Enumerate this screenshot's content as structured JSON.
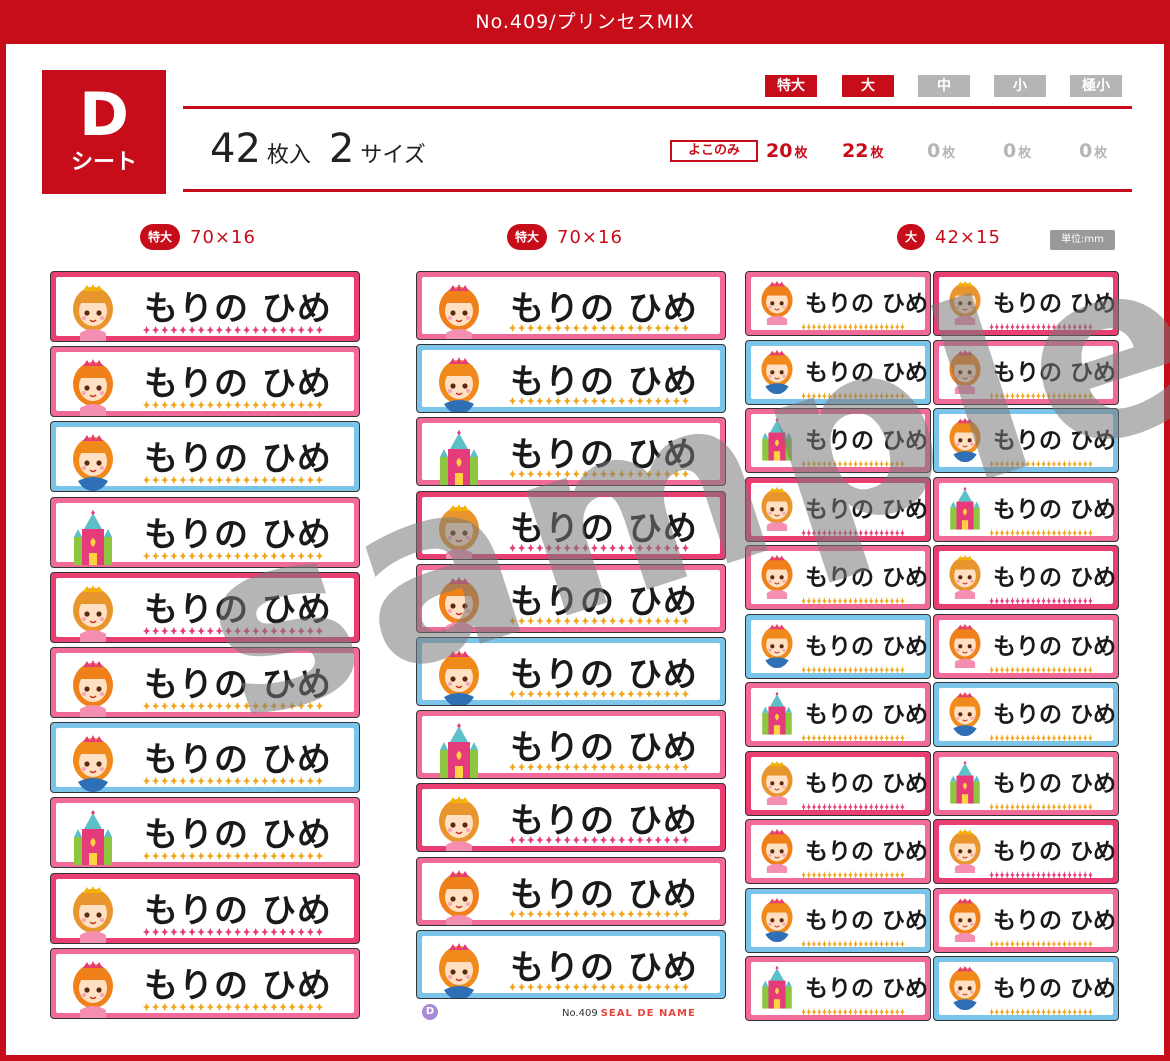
{
  "header": {
    "title": "No.409/プリンセスMIX"
  },
  "sheet": {
    "letter": "D",
    "label": "シート"
  },
  "summary": {
    "count": "42",
    "count_unit": "枚入",
    "sizes": "2",
    "sizes_unit": "サイズ"
  },
  "size_tags": [
    {
      "label": "特大",
      "active": true
    },
    {
      "label": "大",
      "active": true
    },
    {
      "label": "中",
      "active": false
    },
    {
      "label": "小",
      "active": false
    },
    {
      "label": "極小",
      "active": false
    }
  ],
  "orientation": {
    "label": "よこのみ"
  },
  "quantities": [
    {
      "value": "20",
      "unit": "枚",
      "active": true
    },
    {
      "value": "22",
      "unit": "枚",
      "active": true
    },
    {
      "value": "0",
      "unit": "枚",
      "active": false
    },
    {
      "value": "0",
      "unit": "枚",
      "active": false
    },
    {
      "value": "0",
      "unit": "枚",
      "active": false
    }
  ],
  "columns": [
    {
      "tag": "特大",
      "dims": "70×16"
    },
    {
      "tag": "特大",
      "dims": "70×16"
    },
    {
      "tag": "大",
      "dims": "42×15"
    }
  ],
  "unit_note": "単位:mm",
  "label_text": "もりの ひめ",
  "watermark": "sample",
  "footer": {
    "sheet_mark": "D",
    "number": "No.409",
    "brand": "SEAL DE NAME"
  },
  "colors": {
    "brand_red": "#c70c1a",
    "inactive_gray": "#b5b5b5",
    "pink": "#f26a9a",
    "blue": "#7cc5ea",
    "rose": "#e83e72"
  }
}
